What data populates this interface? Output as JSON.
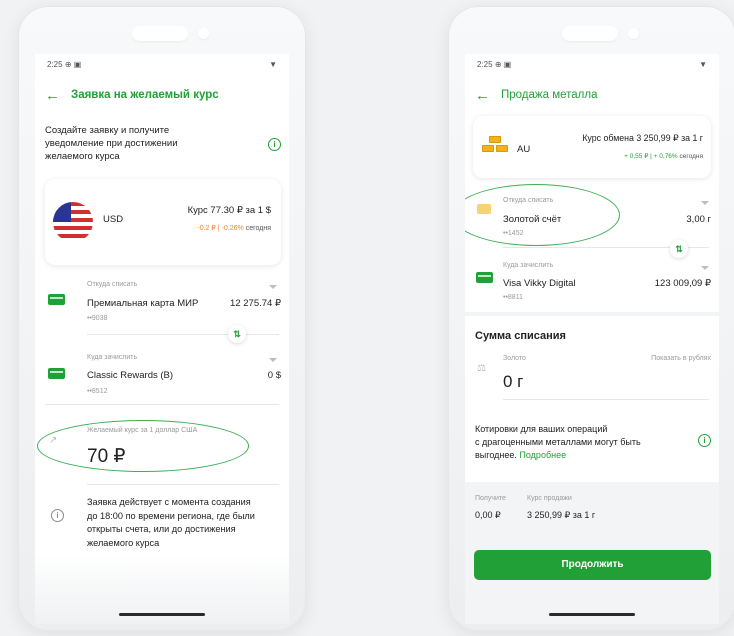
{
  "left": {
    "status_time": "2:25",
    "header_title": "Заявка на желаемый курс",
    "intro_line1": "Создайте заявку и получите",
    "intro_line2": "уведомление при достижении",
    "intro_line3": "желаемого курса",
    "currency": "USD",
    "rate": "Курс 77.30 ₽ за 1 $",
    "change_abs": "-0.2 ₽",
    "change_sep": "|",
    "change_pct": "-0.26%",
    "change_when": "сегодня",
    "from_label": "Откуда списать",
    "from_card": "Премиальная карта МИР",
    "from_amount": "12 275.74 ₽",
    "from_num": "••9038",
    "to_label": "Куда зачислить",
    "to_card": "Classic Rewards (B)",
    "to_amount": "0 $",
    "to_num": "••8512",
    "desired_label": "Желаемый курс за 1 доллар США",
    "desired_value": "70 ₽",
    "note_line1": "Заявка действует с момента создания",
    "note_line2": "до 18:00 по времени региона, где были",
    "note_line3": "открыты счета, или до достижения",
    "note_line4": "желаемого курса"
  },
  "right": {
    "status_time": "2:25",
    "header_title": "Продажа металла",
    "metal": "AU",
    "rate": "Курс обмена 3 250,99 ₽ за 1 г",
    "change_abs": "+ 0,55 ₽",
    "change_sep": "|",
    "change_pct": "+ 0,76%",
    "change_when": "сегодня",
    "from_label": "Откуда списать",
    "from_account": "Золотой счёт",
    "from_amount": "3,00 г",
    "from_num": "••1452",
    "to_label": "Куда зачислить",
    "to_card": "Visa Vikky Digital",
    "to_amount": "123 009,09 ₽",
    "to_num": "••8811",
    "sum_title": "Сумма списания",
    "gold_label": "Золото",
    "show_rub": "Показать в рублях",
    "gold_value": "0 г",
    "quote_line1": "Котировки для ваших операций",
    "quote_line2": "с драгоценными металлами могут быть",
    "quote_line3": "выгоднее.",
    "quote_link": "Подробнее",
    "receive_label": "Получите",
    "receive_value": "0,00 ₽",
    "sell_rate_label": "Курс продажи",
    "sell_rate_value": "3 250,99 ₽ за 1 г",
    "continue_button": "Продолжить"
  }
}
